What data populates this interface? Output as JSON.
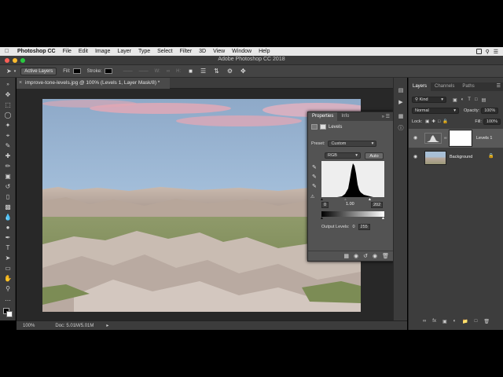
{
  "menubar": {
    "app": "Photoshop CC",
    "items": [
      "File",
      "Edit",
      "Image",
      "Layer",
      "Type",
      "Select",
      "Filter",
      "3D",
      "View",
      "Window",
      "Help"
    ]
  },
  "window": {
    "title": "Adobe Photoshop CC 2018"
  },
  "options": {
    "layer_select": "Active Layers",
    "fill_label": "Fill:",
    "stroke_label": "Stroke:",
    "w_label": "W:",
    "h_label": "H:"
  },
  "document": {
    "tab": "improve-tone-levels.jpg @ 100% (Levels 1, Layer Mask/8) *"
  },
  "status": {
    "zoom": "100%",
    "doc": "Doc: 5.01M/5.01M"
  },
  "properties": {
    "tab_properties": "Properties",
    "tab_info": "Info",
    "title": "Levels",
    "preset_label": "Preset:",
    "preset_value": "Custom",
    "channel": "RGB",
    "auto": "Auto",
    "input_black": "0",
    "input_gamma": "1.00",
    "input_white": "202",
    "output_label": "Output Levels:",
    "output_black": "0",
    "output_white": "255"
  },
  "layers": {
    "tab_layers": "Layers",
    "tab_channels": "Channels",
    "tab_paths": "Paths",
    "kind": "Kind",
    "blend": "Normal",
    "opacity_label": "Opacity:",
    "opacity": "100%",
    "lock_label": "Lock:",
    "fill_label": "Fill:",
    "fill": "100%",
    "items": [
      {
        "name": "Levels 1",
        "selected": true
      },
      {
        "name": "Background",
        "selected": false
      }
    ]
  },
  "colors": {
    "panel": "#535353",
    "ui_dark": "#3c3c3c",
    "canvas_bg": "#282828"
  }
}
